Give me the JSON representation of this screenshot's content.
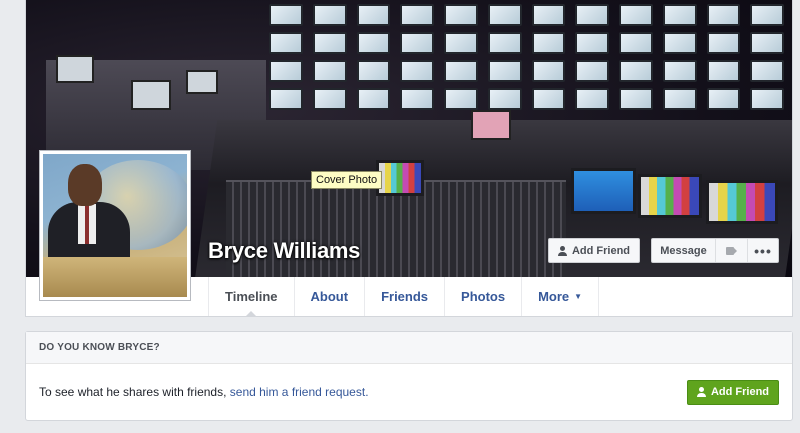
{
  "profile": {
    "name": "Bryce Williams"
  },
  "cover": {
    "tooltip": "Cover Photo",
    "add_friend_label": "Add Friend",
    "message_label": "Message",
    "more_label": "•••"
  },
  "tabs": [
    {
      "label": "Timeline",
      "active": true
    },
    {
      "label": "About"
    },
    {
      "label": "Friends"
    },
    {
      "label": "Photos"
    },
    {
      "label": "More"
    }
  ],
  "know_card": {
    "header": "DO YOU KNOW BRYCE?",
    "text": "To see what he shares with friends,",
    "link": "send him a friend request.",
    "button_label": "Add Friend"
  },
  "colors": {
    "link": "#365899",
    "green": "#5fa41d",
    "background": "#e9ebee"
  }
}
